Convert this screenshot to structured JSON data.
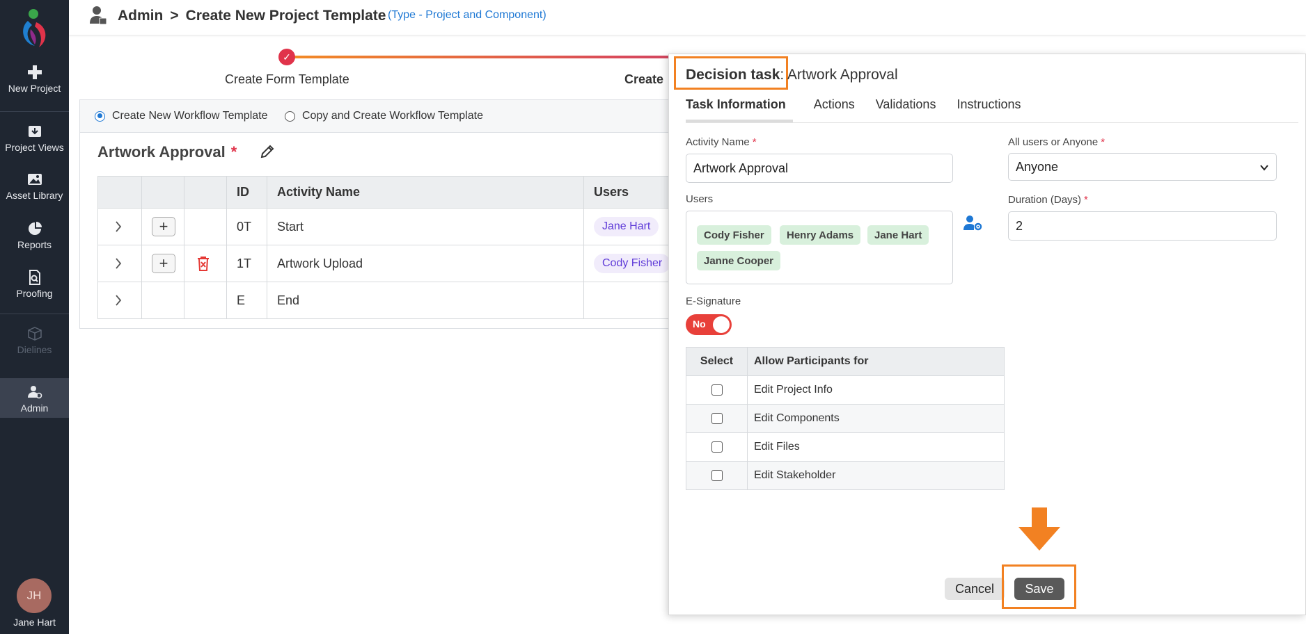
{
  "sidebar": {
    "items": [
      {
        "label": "New Project",
        "icon": "plus-icon"
      },
      {
        "label": "Project Views",
        "icon": "download-box-icon"
      },
      {
        "label": "Asset Library",
        "icon": "image-icon"
      },
      {
        "label": "Reports",
        "icon": "pie-chart-icon"
      },
      {
        "label": "Proofing",
        "icon": "document-search-icon"
      },
      {
        "label": "Dielines",
        "icon": "box-icon"
      },
      {
        "label": "Admin",
        "icon": "admin-user-icon"
      }
    ],
    "user_initials": "JH",
    "user_name": "Jane Hart"
  },
  "header": {
    "root": "Admin",
    "separator": ">",
    "page": "Create New Project Template",
    "type_note": "(Type - Project and Component)"
  },
  "stepper": {
    "step1_label": "Create Form Template",
    "step2_label_partial": "Create"
  },
  "workflow": {
    "option_new": "Create New Workflow Template",
    "option_copy": "Copy and Create Workflow Template",
    "title": "Artwork Approval",
    "required_mark": "*",
    "columns": [
      "ID",
      "Activity Name",
      "Users"
    ],
    "rows": [
      {
        "id": "0T",
        "name": "Start",
        "user": "Jane Hart"
      },
      {
        "id": "1T",
        "name": "Artwork Upload",
        "user": "Cody Fisher"
      },
      {
        "id": "E",
        "name": "End",
        "user": ""
      }
    ]
  },
  "panel": {
    "title_kind": "Decision task",
    "title_name": ": Artwork Approval",
    "tabs": [
      "Task Information",
      "Actions",
      "Validations",
      "Instructions"
    ],
    "activity_name_label": "Activity Name",
    "activity_name_value": "Artwork Approval",
    "all_or_anyone_label": "All users or Anyone",
    "all_or_anyone_value": "Anyone",
    "users_label": "Users",
    "users": [
      "Cody Fisher",
      "Henry Adams",
      "Jane Hart",
      "Janne Cooper"
    ],
    "duration_label": "Duration (Days)",
    "duration_value": "2",
    "esign_label": "E-Signature",
    "esign_value": "No",
    "perm_headers": [
      "Select",
      "Allow Participants for"
    ],
    "permissions": [
      "Edit Project Info",
      "Edit Components",
      "Edit Files",
      "Edit Stakeholder"
    ],
    "cancel_label": "Cancel",
    "save_label": "Save"
  },
  "colors": {
    "sidebar_bg": "#1f2631",
    "accent_orange": "#f28122",
    "link_blue": "#1e78d4",
    "toggle_red": "#e8403a",
    "chip_green": "#d8f0dc"
  }
}
